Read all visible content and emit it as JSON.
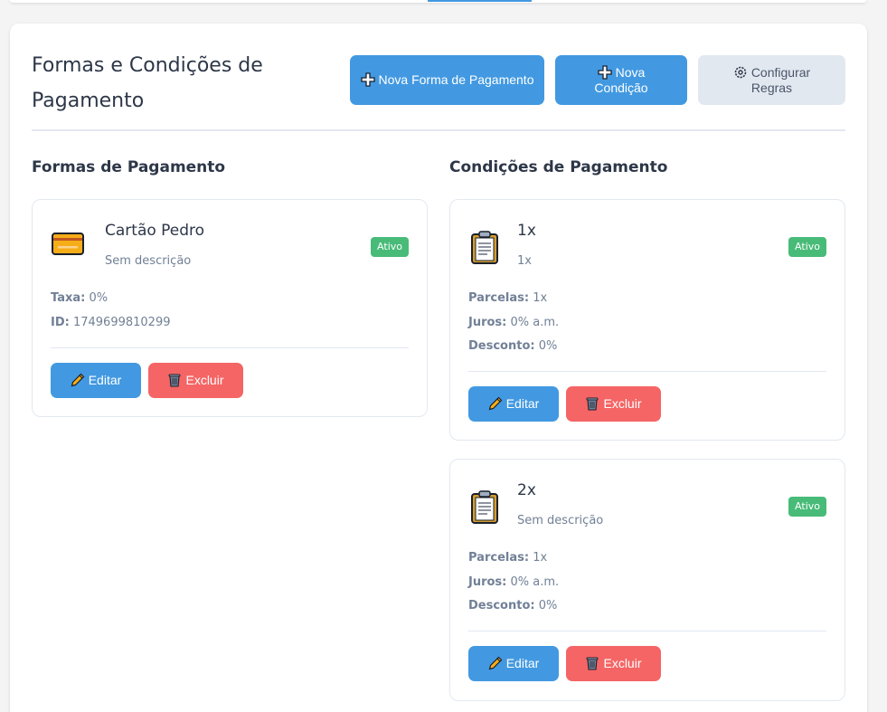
{
  "header": {
    "title": "Formas e Condições de Pagamento",
    "buttons": {
      "nova_forma": "Nova Forma de Pagamento",
      "nova_condicao": "Nova Condição",
      "configurar": "Configurar Regras"
    }
  },
  "formas": {
    "section_title": "Formas de Pagamento",
    "items": [
      {
        "name": "Cartão Pedro",
        "description": "Sem descrição",
        "status": "Ativo",
        "taxa_label": "Taxa:",
        "taxa": "0%",
        "id_label": "ID:",
        "id": "1749699810299",
        "icon": "credit-card-icon"
      }
    ]
  },
  "condicoes": {
    "section_title": "Condições de Pagamento",
    "items": [
      {
        "name": "1x",
        "description": "1x",
        "status": "Ativo",
        "parcelas_label": "Parcelas:",
        "parcelas": "1x",
        "juros_label": "Juros:",
        "juros": "0% a.m.",
        "desconto_label": "Desconto:",
        "desconto": "0%",
        "icon": "clipboard-icon"
      },
      {
        "name": "2x",
        "description": "Sem descrição",
        "status": "Ativo",
        "parcelas_label": "Parcelas:",
        "parcelas": "1x",
        "juros_label": "Juros:",
        "juros": "0% a.m.",
        "desconto_label": "Desconto:",
        "desconto": "0%",
        "icon": "clipboard-icon"
      }
    ]
  },
  "actions": {
    "edit": "Editar",
    "delete": "Excluir"
  },
  "colors": {
    "primary": "#4299e1",
    "danger": "#f56565",
    "success": "#48bb78",
    "muted": "#e2e8f0"
  }
}
